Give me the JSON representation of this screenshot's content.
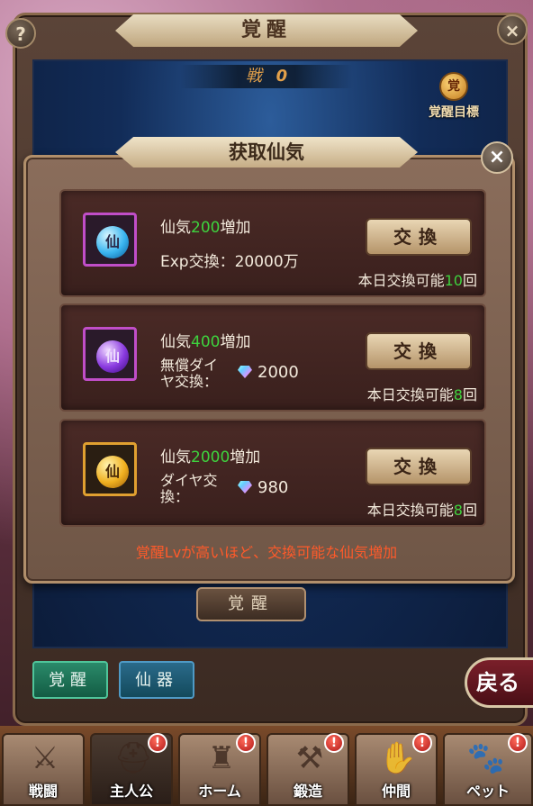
{
  "window": {
    "title": "覚醒",
    "help_icon": "question-icon",
    "close_icon": "close-icon"
  },
  "top": {
    "battle_label": "戦",
    "battle_value": "0",
    "goal_label": "覚醒目標",
    "goal_emblem": "覚"
  },
  "dialog": {
    "title": "获取仙気",
    "rows": [
      {
        "icon_glyph": "仙",
        "prefix": "仙気",
        "amount": "200",
        "suffix": "増加",
        "cost_line1": "Exp交換：20000万",
        "cost_line2": "",
        "cost_value": "",
        "button": "交換",
        "limit_prefix": "本日交換可能",
        "limit_count": "10",
        "limit_suffix": "回",
        "colors": {
          "frame": "#c04ec8",
          "orb": "#3ab5f0"
        }
      },
      {
        "icon_glyph": "仙",
        "prefix": "仙気",
        "amount": "400",
        "suffix": "増加",
        "cost_line1": "無償ダイ",
        "cost_line2": "ヤ交換：",
        "cost_value": "2000",
        "button": "交換",
        "limit_prefix": "本日交換可能",
        "limit_count": "8",
        "limit_suffix": "回",
        "colors": {
          "frame": "#c04ec8",
          "orb": "#8a3ae0"
        }
      },
      {
        "icon_glyph": "仙",
        "prefix": "仙気",
        "amount": "2000",
        "suffix": "増加",
        "cost_line1": "ダイヤ交",
        "cost_line2": "換：",
        "cost_value": "980",
        "button": "交換",
        "limit_prefix": "本日交換可能",
        "limit_count": "8",
        "limit_suffix": "回",
        "colors": {
          "frame": "#e0a030",
          "orb": "#f0b020"
        }
      }
    ],
    "note": "覚醒Lvが高いほど、交換可能な仙気増加"
  },
  "awaken_button": "覚醒",
  "tabs": [
    {
      "label": "覚醒"
    },
    {
      "label": "仙器"
    }
  ],
  "back_button": "戻る",
  "nav": [
    {
      "label": "戦闘",
      "icon": "sword-icon",
      "glyph": "⚔",
      "badge": ""
    },
    {
      "label": "主人公",
      "icon": "helmet-icon",
      "glyph": "⛑",
      "badge": "!"
    },
    {
      "label": "ホーム",
      "icon": "castle-icon",
      "glyph": "🏰",
      "badge": "!"
    },
    {
      "label": "鍛造",
      "icon": "hammer-icon",
      "glyph": "⚒",
      "badge": "!"
    },
    {
      "label": "仲間",
      "icon": "handshake-icon",
      "glyph": "🤝",
      "badge": "!"
    },
    {
      "label": "ペット",
      "icon": "pet-icon",
      "glyph": "🐱",
      "badge": "!"
    }
  ]
}
